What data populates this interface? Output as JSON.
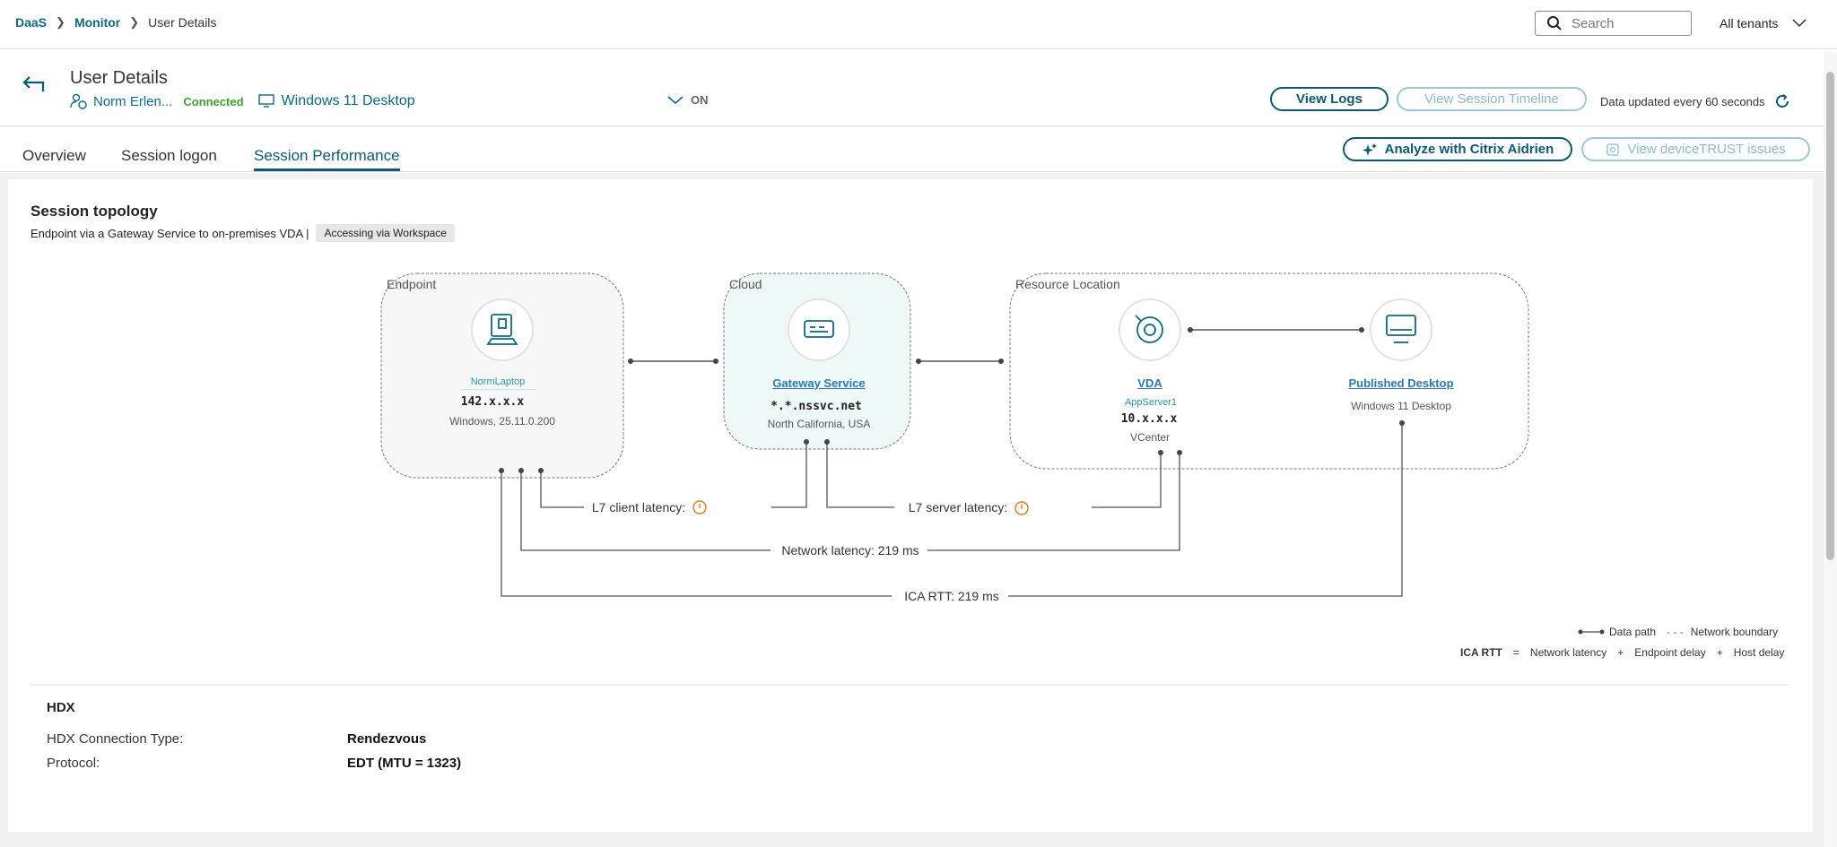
{
  "breadcrumb": {
    "items": [
      "DaaS",
      "Monitor"
    ],
    "current": "User Details"
  },
  "search": {
    "placeholder": "Search"
  },
  "tenant": {
    "label": "All tenants"
  },
  "header": {
    "title": "User Details",
    "user": "Norm Erlen...",
    "status": "Connected",
    "desktop": "Windows 11 Desktop",
    "toggle": "ON",
    "view_logs": "View Logs",
    "view_timeline": "View Session Timeline",
    "updated": "Data updated every 60 seconds",
    "analyze": "Analyze with Citrix Aidrien",
    "devicetrust": "View deviceTRUST issues"
  },
  "tabs": [
    "Overview",
    "Session logon",
    "Session Performance"
  ],
  "topology": {
    "title": "Session topology",
    "subtitle": "Endpoint via a Gateway Service to on-premises VDA |",
    "chip": "Accessing via Workspace",
    "zones": {
      "endpoint": "Endpoint",
      "cloud": "Cloud",
      "resource": "Resource Location"
    },
    "endpoint": {
      "name": "NormLaptop",
      "ip": "142.x.x.x",
      "os": "Windows, 25.11.0.200"
    },
    "gateway": {
      "name": "Gateway Service",
      "host": "*.*.nssvc.net",
      "region": "North California, USA"
    },
    "vda": {
      "name": "VDA",
      "server": "AppServer1",
      "ip": "10.x.x.x",
      "hypervisor": "VCenter"
    },
    "desktop": {
      "name": "Published Desktop",
      "os": "Windows 11 Desktop"
    },
    "latency": {
      "l7_client": "L7 client latency:",
      "l7_server": "L7 server latency:",
      "network": "Network latency: 219 ms",
      "ica_rtt": "ICA RTT: 219 ms"
    },
    "legend": {
      "data_path": "Data path",
      "boundary": "Network boundary",
      "formula": [
        "ICA RTT",
        "=",
        "Network latency",
        "+",
        "Endpoint delay",
        "+",
        "Host delay"
      ]
    }
  },
  "hdx": {
    "title": "HDX",
    "rows": [
      {
        "label": "HDX Connection Type:",
        "value": "Rendezvous"
      },
      {
        "label": "Protocol:",
        "value": "EDT (MTU = 1323)"
      }
    ]
  },
  "colors": {
    "accent": "#0a5a74",
    "connected": "#3ea02f",
    "warning": "#e07b1a"
  }
}
